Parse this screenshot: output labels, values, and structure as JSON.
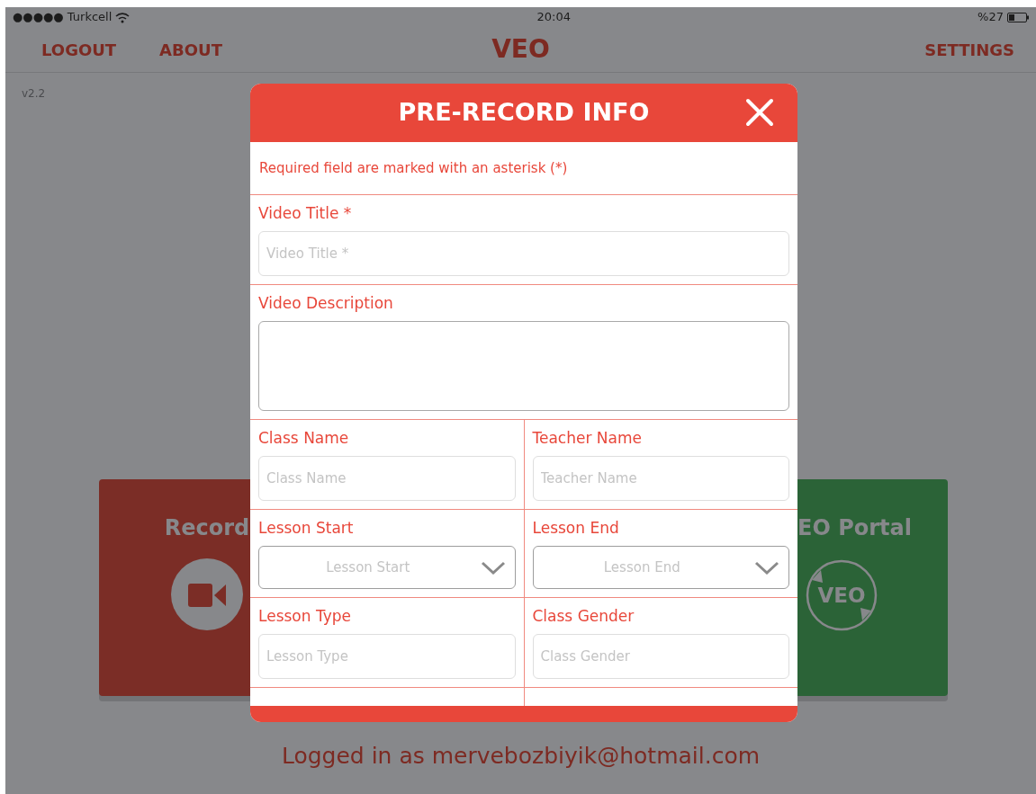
{
  "status_bar": {
    "carrier": "●●●●● Turkcell",
    "time": "20:04",
    "battery": "%27"
  },
  "nav": {
    "left": [
      "LOGOUT",
      "ABOUT"
    ],
    "title": "VEO",
    "right": [
      "SETTINGS"
    ]
  },
  "version": "v2.2",
  "tiles": [
    {
      "kind": "record",
      "title": "Record"
    },
    {
      "kind": "portal",
      "title": "EO Portal",
      "icon_label": "VEO"
    }
  ],
  "modal": {
    "title": "PRE-RECORD INFO",
    "note": "Required field are marked with an asterisk (*)",
    "rows": [
      [
        {
          "kind": "text",
          "label": "Video Title *",
          "placeholder": "Video Title *"
        }
      ],
      [
        {
          "kind": "textarea",
          "label": "Video Description"
        }
      ],
      [
        {
          "kind": "text",
          "label": "Class Name",
          "placeholder": "Class Name"
        },
        {
          "kind": "text",
          "label": "Teacher Name",
          "placeholder": "Teacher Name"
        }
      ],
      [
        {
          "kind": "select",
          "label": "Lesson Start",
          "placeholder": "Lesson Start"
        },
        {
          "kind": "select",
          "label": "Lesson End",
          "placeholder": "Lesson End"
        }
      ],
      [
        {
          "kind": "text",
          "label": "Lesson Type",
          "placeholder": "Lesson Type"
        },
        {
          "kind": "text",
          "label": "Class Gender",
          "placeholder": "Class Gender"
        }
      ]
    ]
  },
  "logged_in": "Logged in as mervebozbiyik@hotmail.com"
}
